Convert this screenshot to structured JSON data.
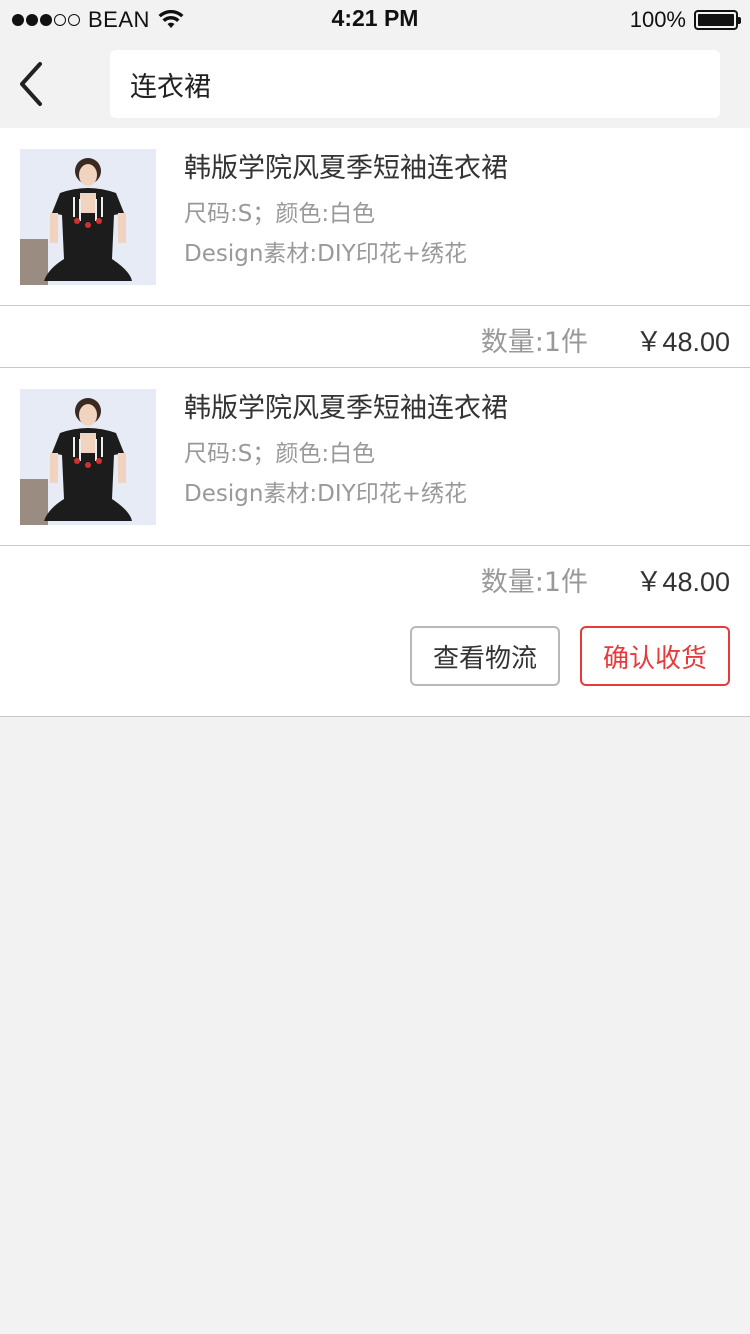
{
  "status_bar": {
    "carrier": "BEAN",
    "time": "4:21 PM",
    "battery": "100%",
    "signal_bars_filled": 3,
    "signal_bars_total": 5
  },
  "nav": {
    "back_icon": "chevron-left-icon",
    "search_value": "连衣裙"
  },
  "order": {
    "items": [
      {
        "title": "韩版学院风夏季短袖连衣裙",
        "spec": "尺码:S；颜色:白色",
        "design": "Design素材:DIY印花+绣花",
        "qty": "数量:1件",
        "price": "￥48.00"
      },
      {
        "title": "韩版学院风夏季短袖连衣裙",
        "spec": "尺码:S；颜色:白色",
        "design": "Design素材:DIY印花+绣花",
        "qty": "数量:1件",
        "price": "￥48.00"
      }
    ],
    "actions": {
      "logistics_label": "查看物流",
      "confirm_label": "确认收货"
    }
  },
  "colors": {
    "background": "#f2f2f2",
    "accent_red": "#e83a3a",
    "muted_text": "#999999",
    "primary_text": "#333333"
  }
}
